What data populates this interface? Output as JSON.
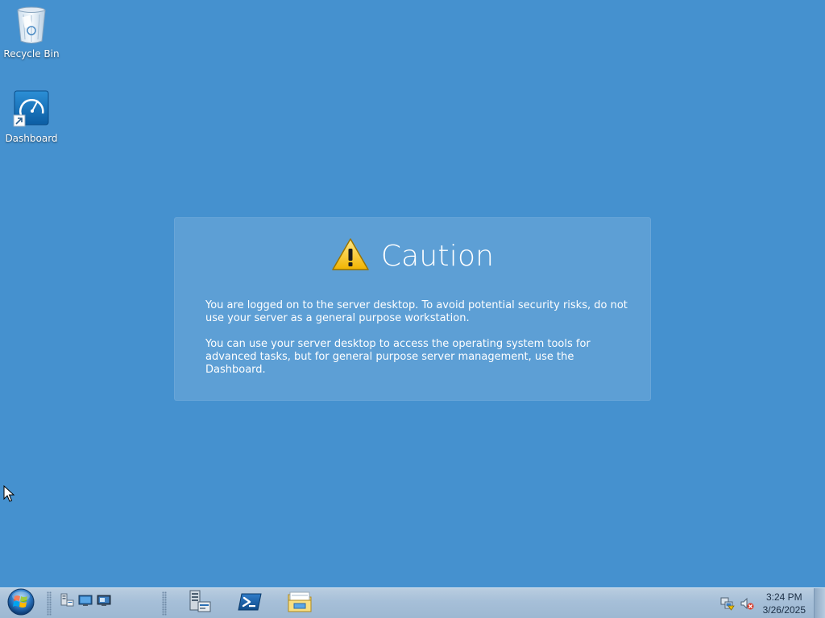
{
  "desktop": {
    "icons": [
      {
        "label": "Recycle Bin",
        "icon": "recycle-bin-icon"
      },
      {
        "label": "Dashboard",
        "icon": "dashboard-icon"
      }
    ],
    "background_color": "#4591cf"
  },
  "caution": {
    "icon": "warning-icon",
    "title": "Caution",
    "paragraph_1": "You are logged on to the server desktop. To avoid potential security risks, do not use your server as a general purpose workstation.",
    "paragraph_2": "You can use your server desktop to access the operating system tools for advanced tasks, but for general purpose server management, use the Dashboard."
  },
  "taskbar": {
    "start_icon": "windows-orb-icon",
    "quick_launch": [
      "server-manager-icon",
      "show-desktop-icon",
      "remote-desktop-icon"
    ],
    "pinned": [
      "server-manager-app-icon",
      "powershell-icon",
      "file-explorer-icon"
    ],
    "tray_icons": [
      "network-icon",
      "volume-muted-icon"
    ],
    "clock": {
      "time": "3:24 PM",
      "date": "3/26/2025"
    }
  }
}
